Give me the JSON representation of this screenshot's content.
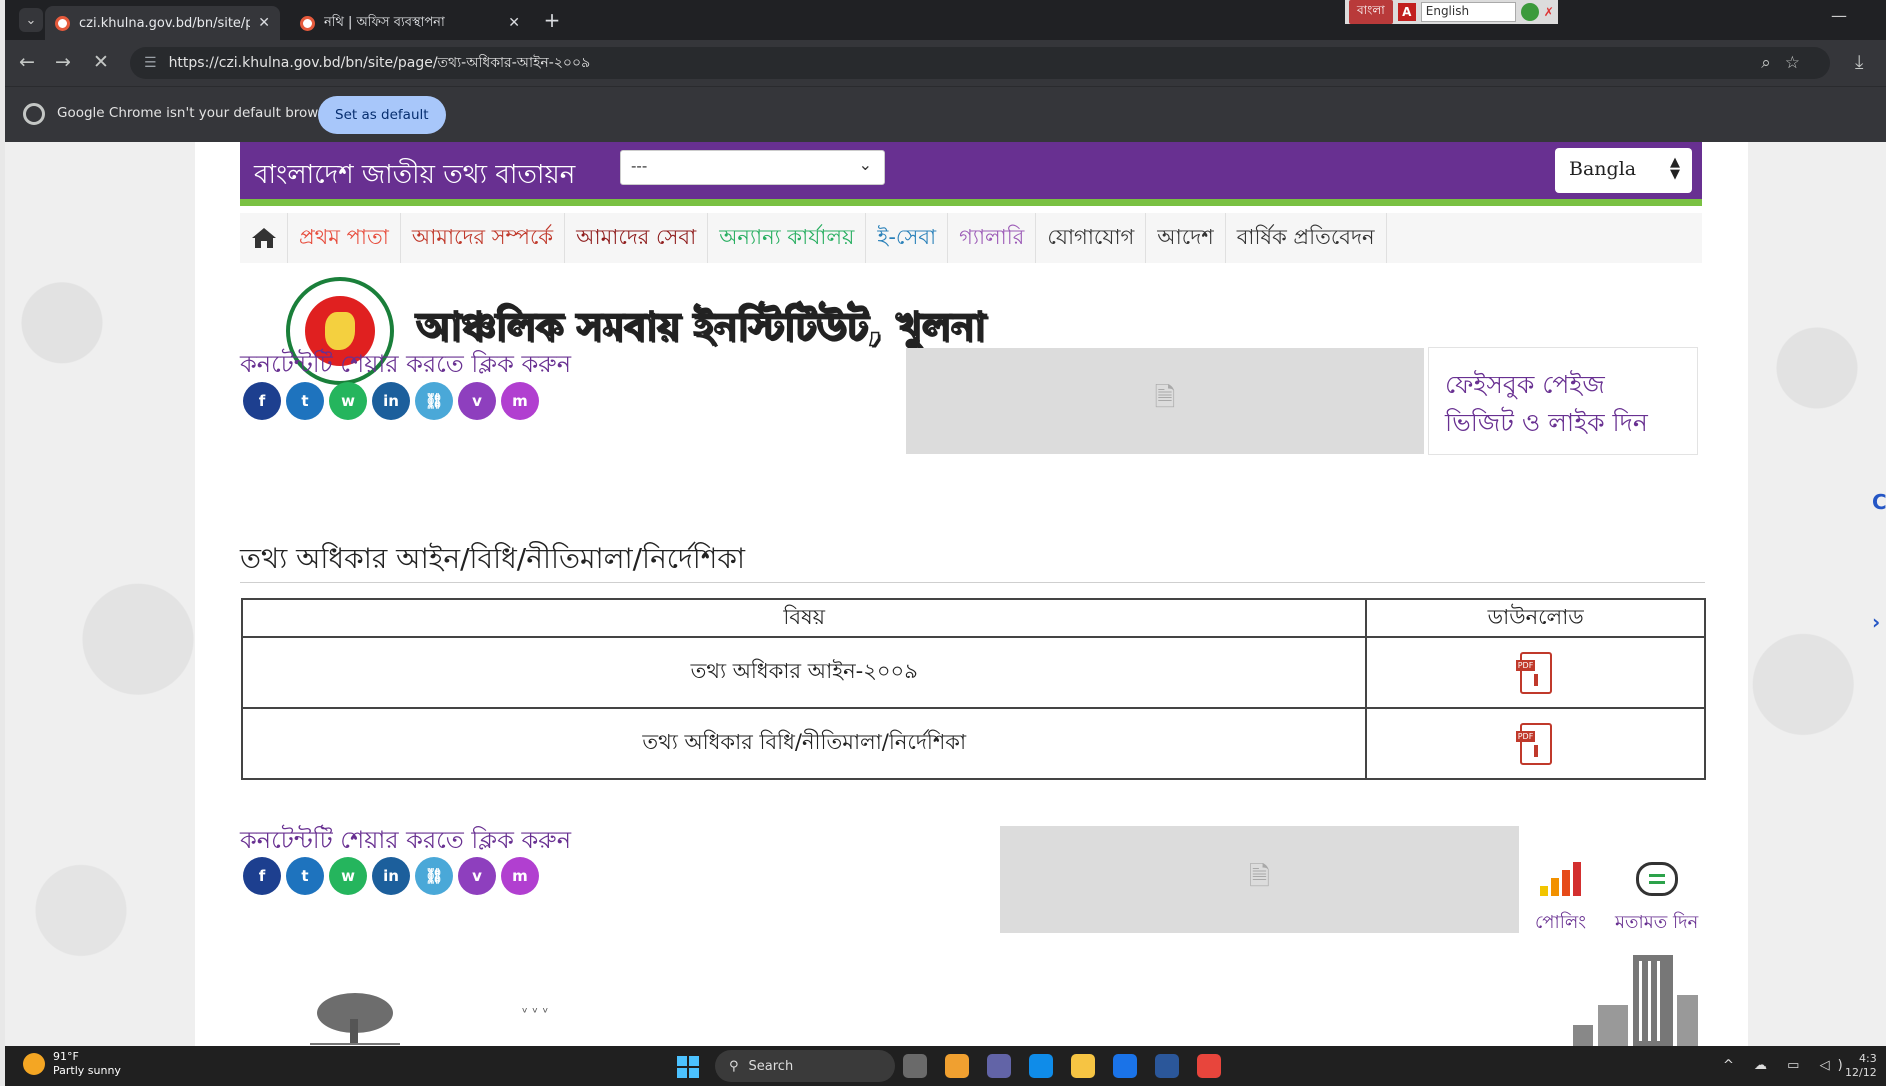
{
  "browser": {
    "tabs": [
      {
        "title": "czi.khulna.gov.bd/bn/site/page",
        "active": true
      },
      {
        "title": "নথি | অফিস ব্যবস্থাপনা",
        "active": false
      }
    ],
    "url": "https://czi.khulna.gov.bd/bn/site/page/তথ্য-অধিকার-আইন-২০০৯",
    "input_bar": {
      "bangla_label": "বাংলা",
      "language_value": "English"
    },
    "infobar": {
      "message": "Google Chrome isn't your default browser",
      "button_label": "Set as default"
    }
  },
  "header": {
    "portal_title": "বাংলাদেশ জাতীয় তথ্য বাতায়ন",
    "ministry_select_value": "---",
    "language_select_value": "Bangla"
  },
  "nav": {
    "items": [
      {
        "label": "প্রথম পাতা",
        "color": "#e74c3c"
      },
      {
        "label": "আমাদের সম্পর্কে",
        "color": "#c0392b"
      },
      {
        "label": "আমাদের সেবা",
        "color": "#8e1b1b"
      },
      {
        "label": "অন্যান্য কার্যালয়",
        "color": "#27ae60"
      },
      {
        "label": "ই-সেবা",
        "color": "#2980b9"
      },
      {
        "label": "গ্যালারি",
        "color": "#9b59b6"
      },
      {
        "label": "যোগাযোগ",
        "color": "#333333"
      },
      {
        "label": "আদেশ",
        "color": "#333333"
      },
      {
        "label": "বার্ষিক প্রতিবেদন",
        "color": "#333333"
      }
    ]
  },
  "site": {
    "name": "আঞ্চলিক সমবায় ইনস্টিটিউট, খুলনা",
    "share_title_top": "কনটেন্টটি শেয়ার করতে ক্লিক করুন",
    "share_title_bottom": "কনটেন্টটি শেয়ার করতে ক্লিক করুন",
    "facebook_box": "ফেইসবুক পেইজ ভিজিট ও লাইক দিন"
  },
  "social_icons": [
    {
      "name": "facebook-icon",
      "glyph": "f",
      "color": "#1d3f8f"
    },
    {
      "name": "twitter-icon",
      "glyph": "t",
      "color": "#1e73be"
    },
    {
      "name": "whatsapp-icon",
      "glyph": "w",
      "color": "#25b55d"
    },
    {
      "name": "linkedin-icon",
      "glyph": "in",
      "color": "#1c5f9c"
    },
    {
      "name": "link-icon",
      "glyph": "⛓",
      "color": "#4aa8d8"
    },
    {
      "name": "viber-icon",
      "glyph": "v",
      "color": "#8e3fbe"
    },
    {
      "name": "messenger-icon",
      "glyph": "m",
      "color": "#b13fd0"
    }
  ],
  "main": {
    "section_title": "তথ্য অধিকার আইন/বিধি/নীতিমালা/নির্দেশিকা",
    "table": {
      "headers": [
        "বিষয়",
        "ডাউনলোড"
      ],
      "rows": [
        {
          "subject": "তথ্য অধিকার আইন-২০০৯"
        },
        {
          "subject": "তথ্য অধিকার বিধি/নীতিমালা/নির্দেশিকা"
        }
      ]
    }
  },
  "widgets": {
    "poll_label": "পোলিং",
    "feedback_label": "মতামত দিন"
  },
  "taskbar": {
    "temperature": "91°F",
    "weather": "Partly sunny",
    "search_placeholder": "Search",
    "time": "4:3",
    "date": "12/12"
  }
}
